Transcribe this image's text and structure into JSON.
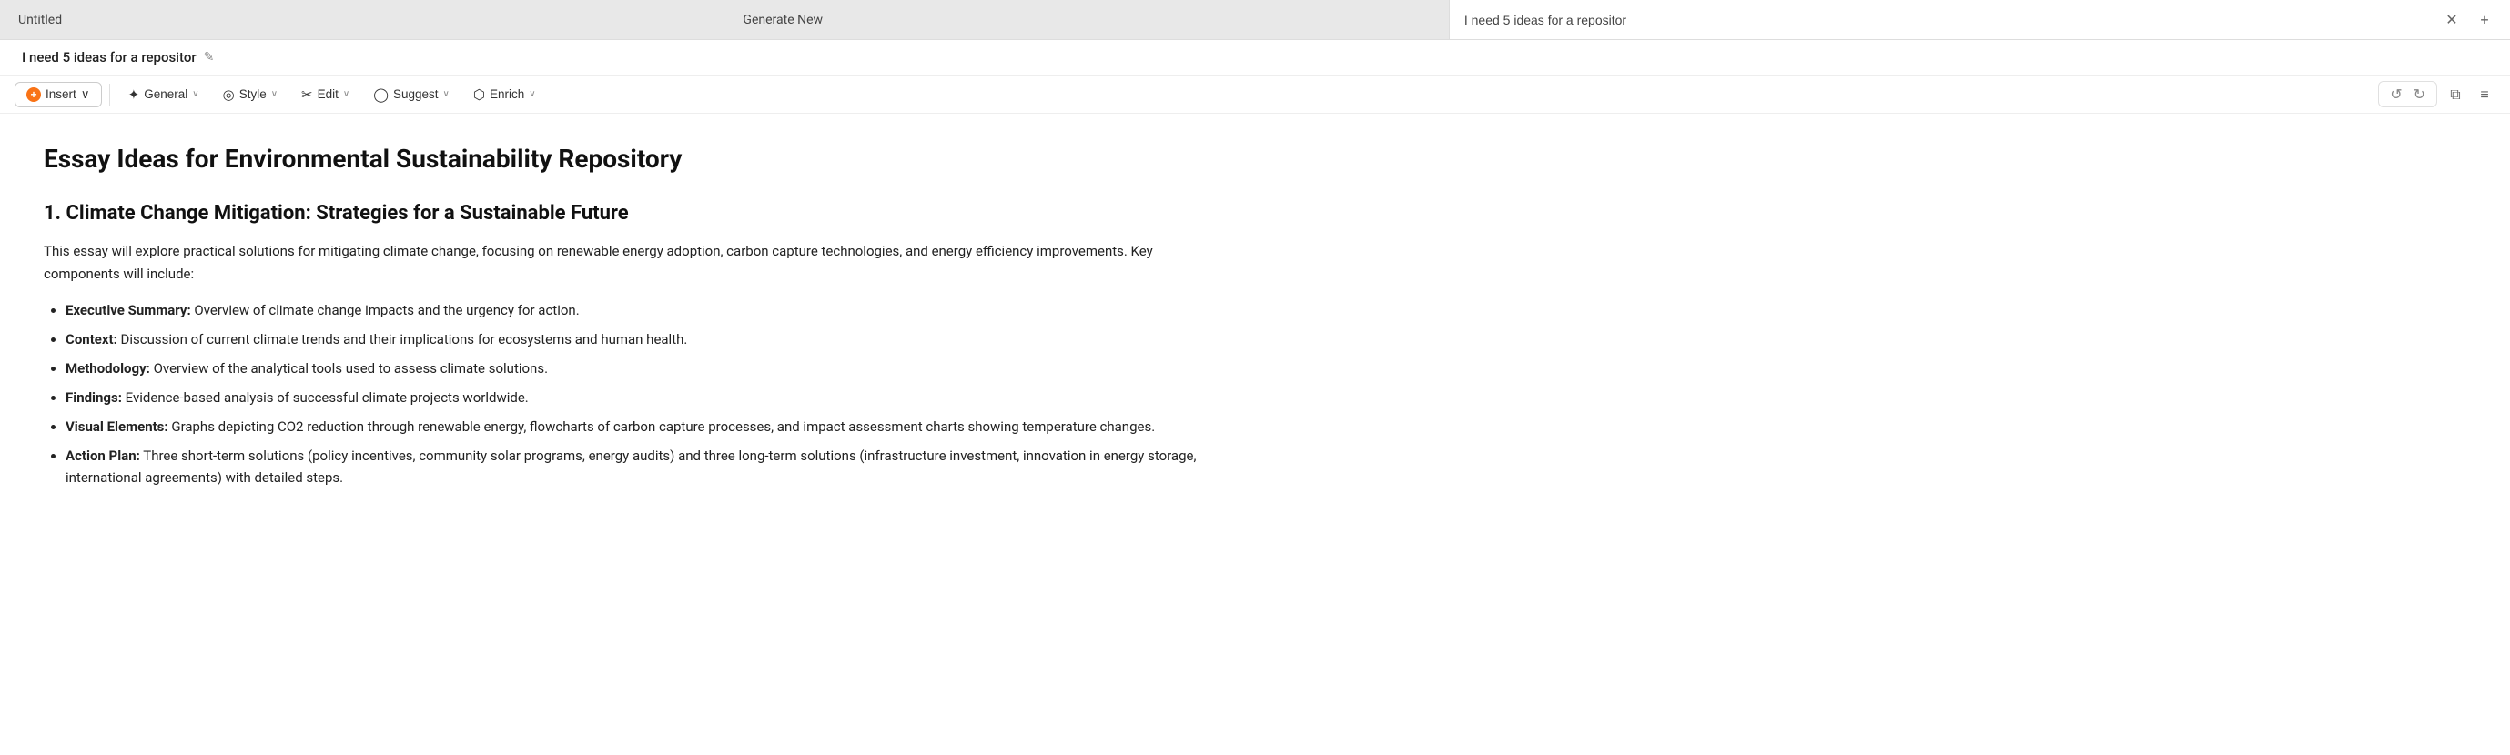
{
  "tabBar": {
    "tab1_label": "Untitled",
    "tab2_label": "Generate New",
    "search_placeholder": "I need 5 ideas for a repositor",
    "search_value": "I need 5 ideas for a repositor",
    "close_icon": "✕",
    "new_tab_icon": "+"
  },
  "docTitleBar": {
    "title": "I need 5 ideas for a repositor",
    "edit_icon": "✎"
  },
  "toolbar": {
    "insert_label": "Insert",
    "insert_icon": "+",
    "general_label": "General",
    "general_icon": "✦",
    "style_label": "Style",
    "style_icon": "◎",
    "edit_label": "Edit",
    "edit_icon": "✂",
    "suggest_label": "Suggest",
    "suggest_icon": "◯",
    "enrich_label": "Enrich",
    "enrich_icon": "⬡",
    "chevron": "∨",
    "undo_icon": "↺",
    "redo_icon": "↻",
    "copy_icon": "⧉",
    "menu_icon": "≡"
  },
  "content": {
    "essay_title": "Essay Ideas for Environmental Sustainability Repository",
    "section1": {
      "heading": "1. Climate Change Mitigation: Strategies for a Sustainable Future",
      "intro": "This essay will explore practical solutions for mitigating climate change, focusing on renewable energy adoption, carbon capture technologies, and energy efficiency improvements. Key components will include:",
      "bullets": [
        {
          "label": "Executive Summary:",
          "text": " Overview of climate change impacts and the urgency for action."
        },
        {
          "label": "Context:",
          "text": " Discussion of current climate trends and their implications for ecosystems and human health."
        },
        {
          "label": "Methodology:",
          "text": " Overview of the analytical tools used to assess climate solutions."
        },
        {
          "label": "Findings:",
          "text": " Evidence-based analysis of successful climate projects worldwide."
        },
        {
          "label": "Visual Elements:",
          "text": " Graphs depicting CO2 reduction through renewable energy, flowcharts of carbon capture processes, and impact assessment charts showing temperature changes."
        },
        {
          "label": "Action Plan:",
          "text": " Three short-term solutions (policy incentives, community solar programs, energy audits) and three long-term solutions (infrastructure investment, innovation in energy storage, international agreements) with detailed steps."
        }
      ]
    }
  }
}
